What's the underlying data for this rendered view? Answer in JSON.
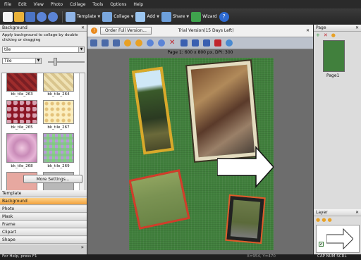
{
  "menu": [
    "File",
    "Edit",
    "View",
    "Photo",
    "Collage",
    "Tools",
    "Options",
    "Help"
  ],
  "toolbar": {
    "template": "Template",
    "collage": "Collage",
    "add": "Add",
    "share": "Share",
    "wizard": "Wizard"
  },
  "left": {
    "panel_title": "Background",
    "instructions": "Apply background to collage by double clicking or dragging",
    "mode_value": "tile",
    "fill_value": "Tile",
    "tiles": [
      "bk_tile_263",
      "bk_tile_264",
      "bk_tile_265",
      "bk_tile_267",
      "bk_tile_268",
      "bk_tile_269"
    ],
    "more_settings": "More Settings...",
    "categories": [
      "Template",
      "Background",
      "Photo",
      "Mask",
      "Frame",
      "Clipart",
      "Shape"
    ]
  },
  "center": {
    "order_button": "Order Full Version...",
    "trial_text": "Trial Version(15 Days Left)",
    "page_info": "Page 1: 600 x 800 px, DPI: 300"
  },
  "right": {
    "page_title": "Page",
    "page_label": "Page1",
    "layer_title": "Layer"
  },
  "status": {
    "help": "For Help, press F1",
    "coords": "X=954, Y=470",
    "indicators": "CAP NUM SCRL"
  },
  "colors": {
    "accent_orange": "#f2a13c",
    "canvas_green": "#41803d",
    "chrome_dark": "#2a2a2a"
  }
}
